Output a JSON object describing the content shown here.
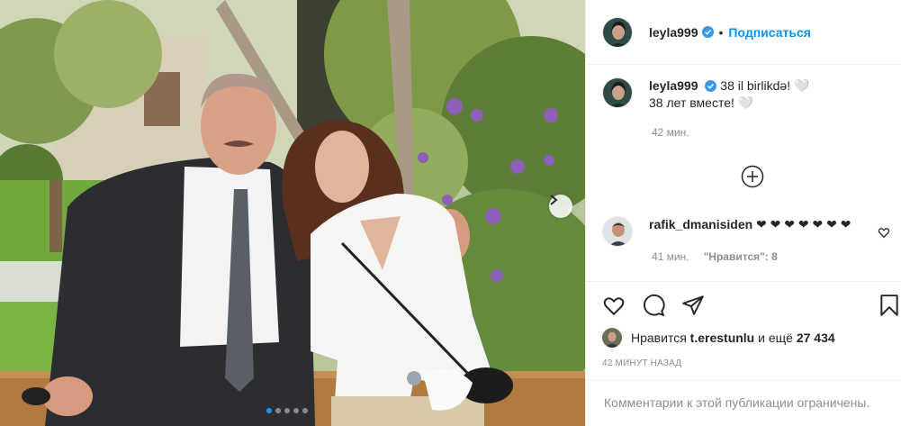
{
  "post": {
    "photo_alt": "",
    "carousel": {
      "total": 5,
      "active_index": 0
    }
  },
  "header": {
    "username": "leyla999",
    "follow_label": "Подписаться",
    "separator": "•"
  },
  "caption": {
    "username": "leyla999",
    "line1": "38 il birlikdə! 🤍",
    "line2": "38 лет вместе! 🤍",
    "time": "42 мин."
  },
  "comment": {
    "username": "rafik_dmanisiden",
    "text": "❤ ❤ ❤ ❤ ❤ ❤ ❤",
    "time": "41 мин.",
    "likes": "\"Нравится\": 8"
  },
  "likes": {
    "prefix": "Нравится",
    "user": "t.erestunlu",
    "suffix": "и ещё",
    "count": "27 434"
  },
  "post_time": "42 минут назад",
  "comments_disabled": "Комментарии к этой публикации ограничены.",
  "icons": [
    "heart-icon",
    "comment-icon",
    "share-icon",
    "bookmark-icon",
    "add-circle-icon",
    "verified-icon",
    "chevron-right-icon"
  ],
  "colors": {
    "accent": "#0095f6",
    "verified": "#3897f0",
    "muted": "#8e8e8e",
    "text": "#262626"
  }
}
